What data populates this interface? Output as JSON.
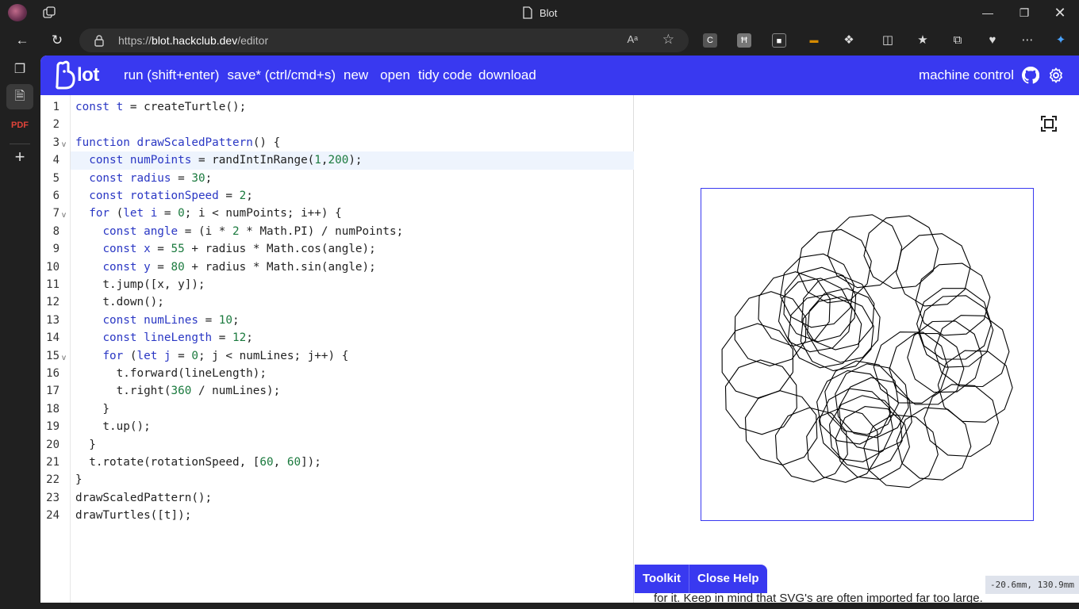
{
  "browser": {
    "window_title": "Blot",
    "url_prefix": "https://",
    "url_host": "blot.hackclub.dev",
    "url_path": "/editor",
    "read_aloud_label": "Aᵃ",
    "extensions": [
      {
        "name": "C",
        "color": "#555555"
      },
      {
        "name": "Ħ",
        "color": "#777777"
      },
      {
        "name": "■",
        "color": "#2a2a2a"
      },
      {
        "name": "▬",
        "color": "#d48a00"
      }
    ]
  },
  "app": {
    "logo_text": "lot",
    "menu": {
      "run": "run (shift+enter)",
      "save": "save* (ctrl/cmd+s)",
      "new": "new",
      "open": "open",
      "tidy": "tidy code",
      "download": "download"
    },
    "machine_control": "machine control",
    "active_line": 4,
    "code_lines": [
      [
        {
          "t": "kw",
          "v": "const"
        },
        {
          "t": "",
          "v": " "
        },
        {
          "t": "vd",
          "v": "t"
        },
        {
          "t": "",
          "v": " = createTurtle();"
        }
      ],
      [],
      [
        {
          "t": "kw",
          "v": "function"
        },
        {
          "t": "",
          "v": " "
        },
        {
          "t": "vd",
          "v": "drawScaledPattern"
        },
        {
          "t": "",
          "v": "() {"
        }
      ],
      [
        {
          "t": "",
          "v": "  "
        },
        {
          "t": "kw",
          "v": "const"
        },
        {
          "t": "",
          "v": " "
        },
        {
          "t": "vd",
          "v": "numPoints"
        },
        {
          "t": "",
          "v": " = randIntInRange("
        },
        {
          "t": "num",
          "v": "1"
        },
        {
          "t": "",
          "v": ","
        },
        {
          "t": "num",
          "v": "200"
        },
        {
          "t": "",
          "v": ");"
        }
      ],
      [
        {
          "t": "",
          "v": "  "
        },
        {
          "t": "kw",
          "v": "const"
        },
        {
          "t": "",
          "v": " "
        },
        {
          "t": "vd",
          "v": "radius"
        },
        {
          "t": "",
          "v": " = "
        },
        {
          "t": "num",
          "v": "30"
        },
        {
          "t": "",
          "v": ";"
        }
      ],
      [
        {
          "t": "",
          "v": "  "
        },
        {
          "t": "kw",
          "v": "const"
        },
        {
          "t": "",
          "v": " "
        },
        {
          "t": "vd",
          "v": "rotationSpeed"
        },
        {
          "t": "",
          "v": " = "
        },
        {
          "t": "num",
          "v": "2"
        },
        {
          "t": "",
          "v": ";"
        }
      ],
      [
        {
          "t": "",
          "v": "  "
        },
        {
          "t": "kw",
          "v": "for"
        },
        {
          "t": "",
          "v": " ("
        },
        {
          "t": "kw",
          "v": "let"
        },
        {
          "t": "",
          "v": " "
        },
        {
          "t": "vd",
          "v": "i"
        },
        {
          "t": "",
          "v": " = "
        },
        {
          "t": "num",
          "v": "0"
        },
        {
          "t": "",
          "v": "; i < numPoints; i++) {"
        }
      ],
      [
        {
          "t": "",
          "v": "    "
        },
        {
          "t": "kw",
          "v": "const"
        },
        {
          "t": "",
          "v": " "
        },
        {
          "t": "vd",
          "v": "angle"
        },
        {
          "t": "",
          "v": " = (i * "
        },
        {
          "t": "num",
          "v": "2"
        },
        {
          "t": "",
          "v": " * Math.PI) / numPoints;"
        }
      ],
      [
        {
          "t": "",
          "v": "    "
        },
        {
          "t": "kw",
          "v": "const"
        },
        {
          "t": "",
          "v": " "
        },
        {
          "t": "vd",
          "v": "x"
        },
        {
          "t": "",
          "v": " = "
        },
        {
          "t": "num",
          "v": "55"
        },
        {
          "t": "",
          "v": " + radius * Math.cos(angle);"
        }
      ],
      [
        {
          "t": "",
          "v": "    "
        },
        {
          "t": "kw",
          "v": "const"
        },
        {
          "t": "",
          "v": " "
        },
        {
          "t": "vd",
          "v": "y"
        },
        {
          "t": "",
          "v": " = "
        },
        {
          "t": "num",
          "v": "80"
        },
        {
          "t": "",
          "v": " + radius * Math.sin(angle);"
        }
      ],
      [
        {
          "t": "",
          "v": "    t.jump([x, y]);"
        }
      ],
      [
        {
          "t": "",
          "v": "    t.down();"
        }
      ],
      [
        {
          "t": "",
          "v": "    "
        },
        {
          "t": "kw",
          "v": "const"
        },
        {
          "t": "",
          "v": " "
        },
        {
          "t": "vd",
          "v": "numLines"
        },
        {
          "t": "",
          "v": " = "
        },
        {
          "t": "num",
          "v": "10"
        },
        {
          "t": "",
          "v": ";"
        }
      ],
      [
        {
          "t": "",
          "v": "    "
        },
        {
          "t": "kw",
          "v": "const"
        },
        {
          "t": "",
          "v": " "
        },
        {
          "t": "vd",
          "v": "lineLength"
        },
        {
          "t": "",
          "v": " = "
        },
        {
          "t": "num",
          "v": "12"
        },
        {
          "t": "",
          "v": ";"
        }
      ],
      [
        {
          "t": "",
          "v": "    "
        },
        {
          "t": "kw",
          "v": "for"
        },
        {
          "t": "",
          "v": " ("
        },
        {
          "t": "kw",
          "v": "let"
        },
        {
          "t": "",
          "v": " "
        },
        {
          "t": "vd",
          "v": "j"
        },
        {
          "t": "",
          "v": " = "
        },
        {
          "t": "num",
          "v": "0"
        },
        {
          "t": "",
          "v": "; j < numLines; j++) {"
        }
      ],
      [
        {
          "t": "",
          "v": "      t.forward(lineLength);"
        }
      ],
      [
        {
          "t": "",
          "v": "      t.right("
        },
        {
          "t": "num",
          "v": "360"
        },
        {
          "t": "",
          "v": " / numLines);"
        }
      ],
      [
        {
          "t": "",
          "v": "    }"
        }
      ],
      [
        {
          "t": "",
          "v": "    t.up();"
        }
      ],
      [
        {
          "t": "",
          "v": "  }"
        }
      ],
      [
        {
          "t": "",
          "v": "  t.rotate(rotationSpeed, ["
        },
        {
          "t": "num",
          "v": "60"
        },
        {
          "t": "",
          "v": ", "
        },
        {
          "t": "num",
          "v": "60"
        },
        {
          "t": "",
          "v": "]);"
        }
      ],
      [
        {
          "t": "",
          "v": "}"
        }
      ],
      [
        {
          "t": "",
          "v": "drawScaledPattern();"
        }
      ],
      [
        {
          "t": "",
          "v": "drawTurtles([t]);"
        }
      ]
    ],
    "fold_lines": [
      3,
      7,
      15
    ],
    "help": {
      "toolkit": "Toolkit",
      "close_help": "Close Help",
      "text": "for it. Keep in mind that SVG's are often imported far too large."
    },
    "coords_readout": "-20.6mm,  130.9mm",
    "accent_color": "#3939f0"
  }
}
